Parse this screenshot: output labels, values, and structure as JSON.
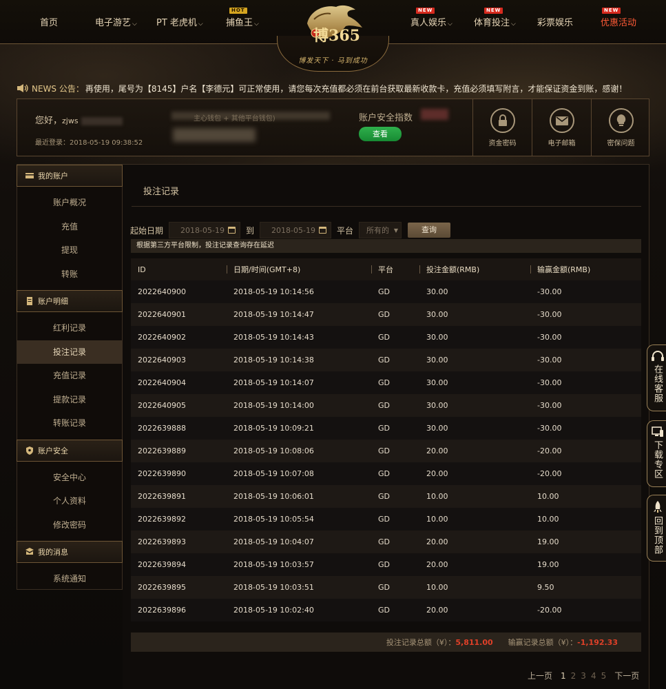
{
  "nav": {
    "items": [
      {
        "label": "首页",
        "chevron": false,
        "tag": ""
      },
      {
        "label": "电子游艺",
        "chevron": true,
        "tag": ""
      },
      {
        "label": "PT 老虎机",
        "chevron": true,
        "tag": ""
      },
      {
        "label": "捕鱼王",
        "chevron": true,
        "tag": "HOT"
      },
      {
        "label": "真人娱乐",
        "chevron": true,
        "tag": "NEW"
      },
      {
        "label": "体育投注",
        "chevron": true,
        "tag": "NEW"
      },
      {
        "label": "彩票娱乐",
        "chevron": false,
        "tag": ""
      },
      {
        "label": "优惠活动",
        "chevron": false,
        "tag": "NEW"
      }
    ],
    "logo_text": "博365",
    "logo_slogan": "博发天下 · 马到成功"
  },
  "news": {
    "label": "NEWS 公告：",
    "text": "再使用，尾号为【8145】户名【李德元】可正常使用，请您每次充值都必须在前台获取最新收款卡，充值必须填写附言，才能保证资金到账，感谢！"
  },
  "account": {
    "greeting": "您好，",
    "username_prefix": "zjws",
    "last_login_label": "最近登录：",
    "last_login_time": "2018-05-19 09:38:52",
    "wallet_label": "主心钱包 + 其他平台钱包)",
    "security_label": "账户安全指数",
    "view_button": "查看",
    "security_boxes": [
      {
        "label": "资金密码",
        "icon": "lock-icon"
      },
      {
        "label": "电子邮箱",
        "icon": "mail-icon"
      },
      {
        "label": "密保问题",
        "icon": "bulb-icon"
      }
    ]
  },
  "sidebar": {
    "sections": [
      {
        "title": "我的账户",
        "icon": "card-icon",
        "items": [
          "账户概况",
          "充值",
          "提现",
          "转账"
        ]
      },
      {
        "title": "账户明细",
        "icon": "document-icon",
        "items": [
          "红利记录",
          "投注记录",
          "充值记录",
          "提款记录",
          "转账记录"
        ]
      },
      {
        "title": "账户安全",
        "icon": "shield-icon",
        "items": [
          "安全中心",
          "个人资料",
          "修改密码"
        ]
      },
      {
        "title": "我的消息",
        "icon": "message-icon",
        "items": [
          "系统通知"
        ]
      }
    ],
    "active_item": "投注记录"
  },
  "main": {
    "title": "投注记录",
    "filters": {
      "start_label": "起始日期",
      "start_date": "2018-05-19",
      "to_label": "到",
      "end_date": "2018-05-19",
      "platform_label": "平台",
      "platform_value": "所有的",
      "query_button": "查询"
    },
    "notice": "根据第三方平台限制，投注记录查询存在延迟",
    "table": {
      "headers": [
        "ID",
        "日期/时间(GMT+8)",
        "平台",
        "投注金额(RMB)",
        "输赢金额(RMB)"
      ],
      "rows": [
        [
          "2022640900",
          "2018-05-19 10:14:56",
          "GD",
          "30.00",
          "-30.00"
        ],
        [
          "2022640901",
          "2018-05-19 10:14:47",
          "GD",
          "30.00",
          "-30.00"
        ],
        [
          "2022640902",
          "2018-05-19 10:14:43",
          "GD",
          "30.00",
          "-30.00"
        ],
        [
          "2022640903",
          "2018-05-19 10:14:38",
          "GD",
          "30.00",
          "-30.00"
        ],
        [
          "2022640904",
          "2018-05-19 10:14:07",
          "GD",
          "30.00",
          "-30.00"
        ],
        [
          "2022640905",
          "2018-05-19 10:14:00",
          "GD",
          "30.00",
          "-30.00"
        ],
        [
          "2022639888",
          "2018-05-19 10:09:21",
          "GD",
          "30.00",
          "-30.00"
        ],
        [
          "2022639889",
          "2018-05-19 10:08:06",
          "GD",
          "20.00",
          "-20.00"
        ],
        [
          "2022639890",
          "2018-05-19 10:07:08",
          "GD",
          "20.00",
          "-20.00"
        ],
        [
          "2022639891",
          "2018-05-19 10:06:01",
          "GD",
          "10.00",
          "10.00"
        ],
        [
          "2022639892",
          "2018-05-19 10:05:54",
          "GD",
          "10.00",
          "10.00"
        ],
        [
          "2022639893",
          "2018-05-19 10:04:07",
          "GD",
          "20.00",
          "19.00"
        ],
        [
          "2022639894",
          "2018-05-19 10:03:57",
          "GD",
          "20.00",
          "19.00"
        ],
        [
          "2022639895",
          "2018-05-19 10:03:51",
          "GD",
          "10.00",
          "9.50"
        ],
        [
          "2022639896",
          "2018-05-19 10:02:40",
          "GD",
          "20.00",
          "-20.00"
        ]
      ]
    },
    "totals": {
      "bet_label": "投注记录总额（¥）：",
      "bet_value": "5,811.00",
      "win_label": "输赢记录总额（¥）：",
      "win_value": "-1,192.33"
    },
    "pager": {
      "prev": "上一页",
      "pages": [
        "1",
        "2",
        "3",
        "4",
        "5"
      ],
      "next": "下一页",
      "current": "1"
    }
  },
  "float_tabs": [
    {
      "label": "在线客服",
      "icon": "headset-icon"
    },
    {
      "label": "下载专区",
      "icon": "monitor-icon"
    },
    {
      "label": "回到顶部",
      "icon": "rocket-icon"
    }
  ],
  "colors": {
    "accent_gold": "#d4b77c",
    "promo_red": "#ff5a36",
    "total_red": "#e04028",
    "view_green": "#2fb04c"
  }
}
